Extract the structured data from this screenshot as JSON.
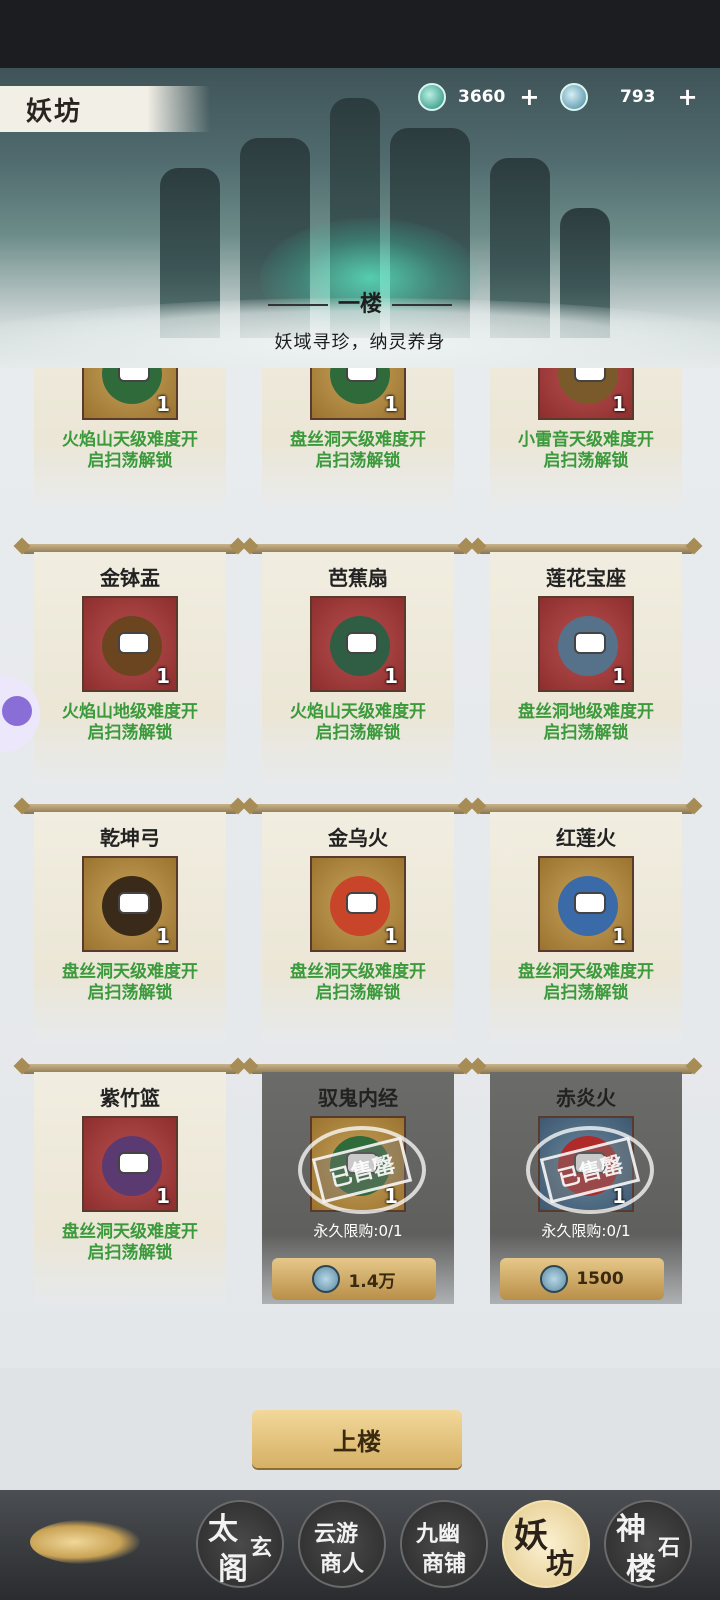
{
  "header": {
    "title": "妖坊",
    "currency1": {
      "value": "3660",
      "plus": "+",
      "icon": "jade-coin-icon"
    },
    "currency2": {
      "value": "793",
      "plus": "+",
      "icon": "spirit-coin-icon"
    }
  },
  "floor": {
    "title": "一楼",
    "subtitle": "妖域寻珍，纳灵养身"
  },
  "colors": {
    "unlock_green": "#3b9a3b",
    "accent_gold": "#d6b065"
  },
  "items": [
    {
      "name": "",
      "qty": "1",
      "bg": "gold",
      "unlock1": "火焰山天级难度开",
      "unlock2": "启扫荡解锁",
      "icon": "book-icon"
    },
    {
      "name": "",
      "qty": "1",
      "bg": "gold",
      "unlock1": "盘丝洞天级难度开",
      "unlock2": "启扫荡解锁",
      "icon": "book-icon"
    },
    {
      "name": "",
      "qty": "1",
      "bg": "red",
      "unlock1": "小雷音天级难度开",
      "unlock2": "启扫荡解锁",
      "icon": "cymbal-icon"
    },
    {
      "name": "金钵盂",
      "qty": "1",
      "bg": "red",
      "unlock1": "火焰山地级难度开",
      "unlock2": "启扫荡解锁",
      "icon": "bowl-icon"
    },
    {
      "name": "芭蕉扇",
      "qty": "1",
      "bg": "red",
      "unlock1": "火焰山天级难度开",
      "unlock2": "启扫荡解锁",
      "icon": "fan-icon"
    },
    {
      "name": "莲花宝座",
      "qty": "1",
      "bg": "red",
      "unlock1": "盘丝洞地级难度开",
      "unlock2": "启扫荡解锁",
      "icon": "lotus-icon"
    },
    {
      "name": "乾坤弓",
      "qty": "1",
      "bg": "gold",
      "unlock1": "盘丝洞天级难度开",
      "unlock2": "启扫荡解锁",
      "icon": "bow-icon"
    },
    {
      "name": "金乌火",
      "qty": "1",
      "bg": "gold",
      "unlock1": "盘丝洞天级难度开",
      "unlock2": "启扫荡解锁",
      "icon": "fire-icon"
    },
    {
      "name": "红莲火",
      "qty": "1",
      "bg": "gold",
      "unlock1": "盘丝洞天级难度开",
      "unlock2": "启扫荡解锁",
      "icon": "blue-fire-icon"
    },
    {
      "name": "紫竹篮",
      "qty": "1",
      "bg": "red",
      "unlock1": "盘丝洞天级难度开",
      "unlock2": "启扫荡解锁",
      "icon": "basket-icon"
    },
    {
      "name": "驭鬼内经",
      "qty": "1",
      "bg": "gold",
      "sold": "已售罄",
      "limit": "永久限购:0/1",
      "price": "1.4万",
      "icon": "book-icon"
    },
    {
      "name": "赤炎火",
      "qty": "1",
      "bg": "blue",
      "sold": "已售罄",
      "limit": "永久限购:0/1",
      "price": "1500",
      "icon": "red-fire-icon"
    }
  ],
  "upstairs_label": "上楼",
  "nav": [
    {
      "line1": "太",
      "line2": "阁",
      "line3": "玄",
      "id": "taixuan"
    },
    {
      "line1": "云游",
      "line2": "商人",
      "line3": "",
      "id": "yunyou"
    },
    {
      "line1": "九幽",
      "line2": "商铺",
      "line3": "",
      "id": "jiuyou"
    },
    {
      "line1": "妖",
      "line2": "坊",
      "line3": "",
      "id": "yaofang"
    },
    {
      "line1": "神",
      "line2": "楼",
      "line3": "石",
      "id": "shenshi"
    }
  ]
}
